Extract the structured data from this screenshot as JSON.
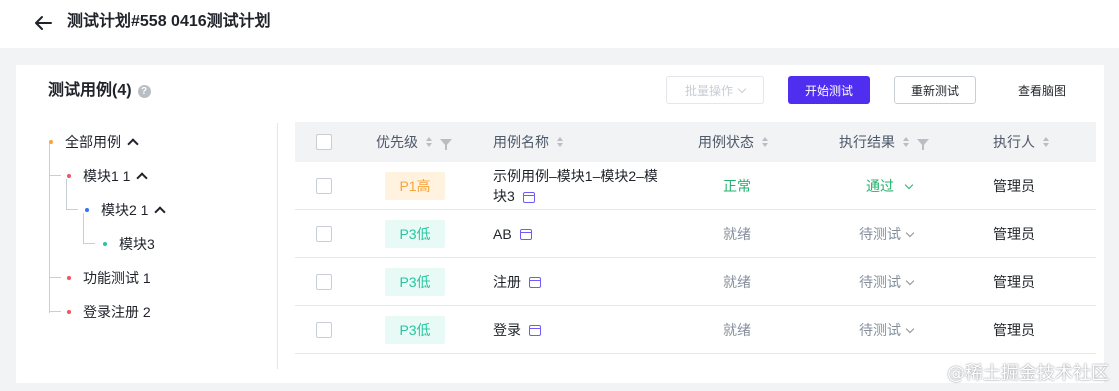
{
  "header": {
    "title": "测试计划#558 0416测试计划"
  },
  "section": {
    "title": "测试用例(4)",
    "help": "?"
  },
  "toolbar": {
    "batch_label": "批量操作",
    "start_label": "开始测试",
    "retest_label": "重新测试",
    "mind_label": "查看脑图"
  },
  "tree": {
    "root": "全部用例",
    "module1": "模块1 1",
    "module2": "模块2 1",
    "module3": "模块3",
    "func": "功能测试 1",
    "login": "登录注册 2"
  },
  "table": {
    "headers": {
      "priority": "优先级",
      "name": "用例名称",
      "state": "用例状态",
      "result": "执行结果",
      "executor": "执行人"
    },
    "rows": [
      {
        "priority": "P1高",
        "name": "示例用例–模块1–模块2–模块3",
        "state": "正常",
        "result": "通过",
        "executor": "管理员"
      },
      {
        "priority": "P3低",
        "name": "AB",
        "state": "就绪",
        "result": "待测试",
        "executor": "管理员"
      },
      {
        "priority": "P3低",
        "name": "注册",
        "state": "就绪",
        "result": "待测试",
        "executor": "管理员"
      },
      {
        "priority": "P3低",
        "name": "登录",
        "state": "就绪",
        "result": "待测试",
        "executor": "管理员"
      }
    ]
  },
  "watermark": "@稀土掘金技术社区",
  "colors": {
    "primary": "#4f2ef0",
    "success": "#23b26d",
    "warning": "#f7a43b",
    "low": "#26c6a0"
  }
}
